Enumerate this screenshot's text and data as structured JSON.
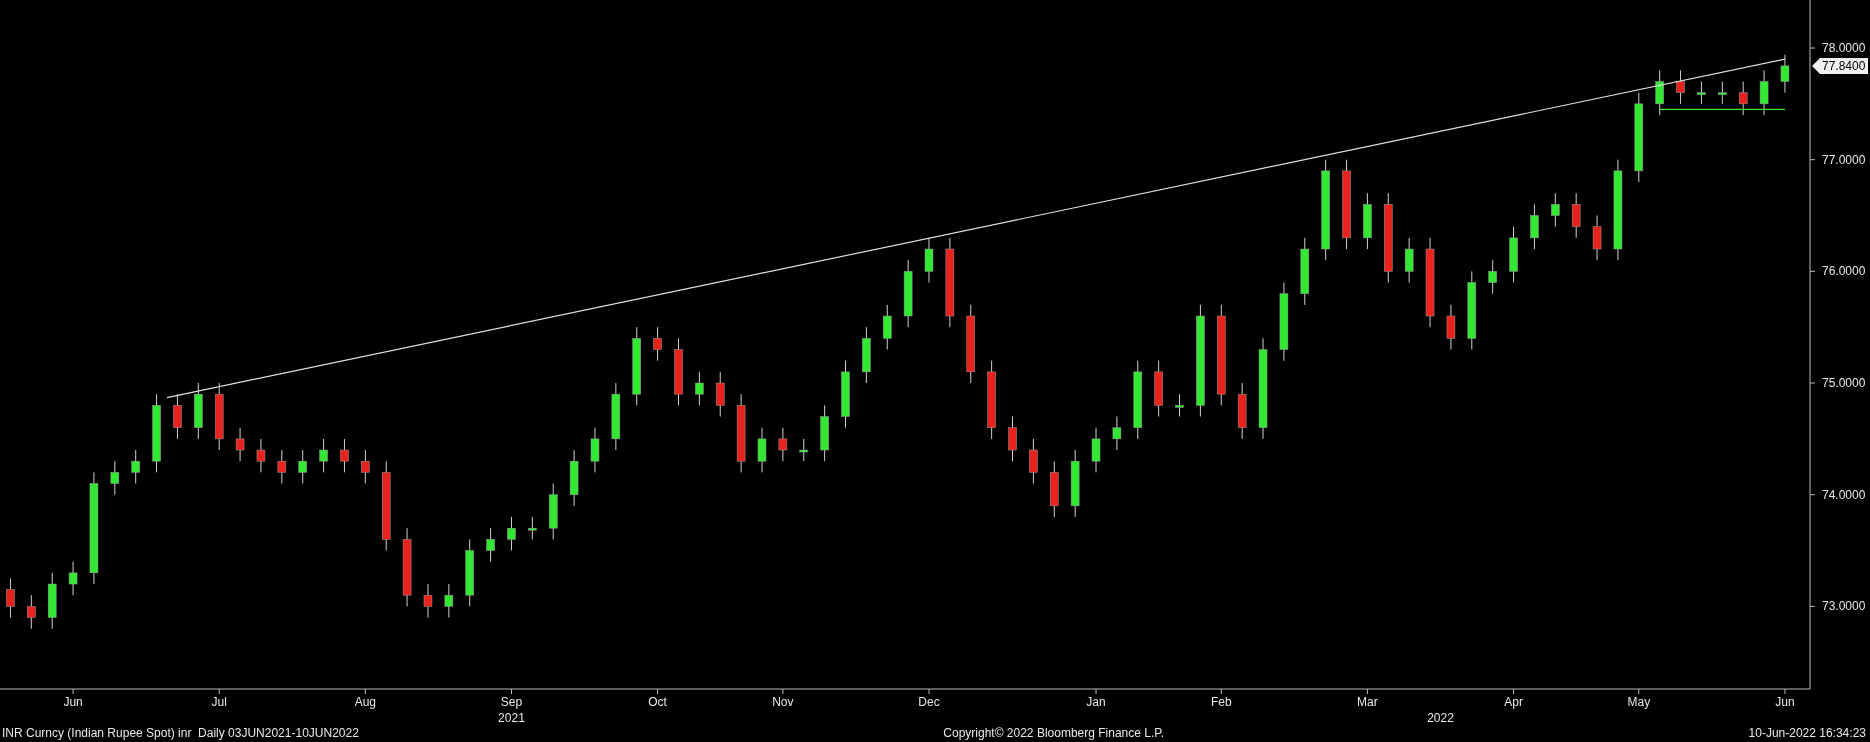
{
  "chart": {
    "chart_data": {
      "type": "candlestick",
      "ylim": [
        72.26,
        78.43
      ],
      "yticks": [
        {
          "value": 73,
          "label": "73.0000"
        },
        {
          "value": 74,
          "label": "74.0000"
        },
        {
          "value": 75,
          "label": "75.0000"
        },
        {
          "value": 76,
          "label": "76.0000"
        },
        {
          "value": 77,
          "label": "77.0000"
        },
        {
          "value": 78,
          "label": "78.0000"
        }
      ],
      "categories": [
        null,
        null,
        null,
        "Jun",
        null,
        null,
        null,
        null,
        null,
        null,
        "Jul",
        null,
        null,
        null,
        null,
        null,
        null,
        "Aug",
        null,
        null,
        null,
        null,
        null,
        null,
        "Sep",
        null,
        null,
        null,
        null,
        null,
        null,
        "Oct",
        null,
        null,
        null,
        null,
        null,
        "Nov",
        null,
        null,
        null,
        null,
        null,
        null,
        "Dec",
        null,
        null,
        null,
        null,
        null,
        null,
        null,
        "Jan",
        null,
        null,
        null,
        null,
        null,
        "Feb",
        null,
        null,
        null,
        null,
        null,
        null,
        "Mar",
        null,
        null,
        null,
        null,
        null,
        null,
        "Apr",
        null,
        null,
        null,
        null,
        null,
        "May",
        null,
        null,
        null,
        null,
        null,
        null,
        "Jun"
      ],
      "ohlc": [
        [
          73.15,
          73.25,
          72.9,
          73.0
        ],
        [
          73.0,
          73.1,
          72.8,
          72.9
        ],
        [
          72.9,
          73.3,
          72.8,
          73.2
        ],
        [
          73.2,
          73.4,
          73.1,
          73.3
        ],
        [
          73.3,
          74.2,
          73.2,
          74.1
        ],
        [
          74.1,
          74.3,
          74.0,
          74.2
        ],
        [
          74.2,
          74.4,
          74.1,
          74.3
        ],
        [
          74.3,
          74.9,
          74.2,
          74.8
        ],
        [
          74.8,
          74.9,
          74.5,
          74.6
        ],
        [
          74.6,
          75.0,
          74.5,
          74.9
        ],
        [
          74.9,
          75.0,
          74.4,
          74.5
        ],
        [
          74.5,
          74.6,
          74.3,
          74.4
        ],
        [
          74.4,
          74.5,
          74.2,
          74.3
        ],
        [
          74.3,
          74.4,
          74.1,
          74.2
        ],
        [
          74.2,
          74.4,
          74.1,
          74.3
        ],
        [
          74.3,
          74.5,
          74.2,
          74.4
        ],
        [
          74.4,
          74.5,
          74.2,
          74.3
        ],
        [
          74.3,
          74.4,
          74.1,
          74.2
        ],
        [
          74.2,
          74.3,
          73.5,
          73.6
        ],
        [
          73.6,
          73.7,
          73.0,
          73.1
        ],
        [
          73.1,
          73.2,
          72.9,
          73.0
        ],
        [
          73.0,
          73.2,
          72.9,
          73.1
        ],
        [
          73.1,
          73.6,
          73.0,
          73.5
        ],
        [
          73.5,
          73.7,
          73.4,
          73.6
        ],
        [
          73.6,
          73.8,
          73.5,
          73.7
        ],
        [
          73.7,
          73.8,
          73.6,
          73.7
        ],
        [
          73.7,
          74.1,
          73.6,
          74.0
        ],
        [
          74.0,
          74.4,
          73.9,
          74.3
        ],
        [
          74.3,
          74.6,
          74.2,
          74.5
        ],
        [
          74.5,
          75.0,
          74.4,
          74.9
        ],
        [
          74.9,
          75.5,
          74.8,
          75.4
        ],
        [
          75.4,
          75.5,
          75.2,
          75.3
        ],
        [
          75.3,
          75.4,
          74.8,
          74.9
        ],
        [
          74.9,
          75.1,
          74.8,
          75.0
        ],
        [
          75.0,
          75.1,
          74.7,
          74.8
        ],
        [
          74.8,
          74.9,
          74.2,
          74.3
        ],
        [
          74.3,
          74.6,
          74.2,
          74.5
        ],
        [
          74.5,
          74.6,
          74.3,
          74.4
        ],
        [
          74.4,
          74.5,
          74.3,
          74.4
        ],
        [
          74.4,
          74.8,
          74.3,
          74.7
        ],
        [
          74.7,
          75.2,
          74.6,
          75.1
        ],
        [
          75.1,
          75.5,
          75.0,
          75.4
        ],
        [
          75.4,
          75.7,
          75.3,
          75.6
        ],
        [
          75.6,
          76.1,
          75.5,
          76.0
        ],
        [
          76.0,
          76.3,
          75.9,
          76.2
        ],
        [
          76.2,
          76.3,
          75.5,
          75.6
        ],
        [
          75.6,
          75.7,
          75.0,
          75.1
        ],
        [
          75.1,
          75.2,
          74.5,
          74.6
        ],
        [
          74.6,
          74.7,
          74.3,
          74.4
        ],
        [
          74.4,
          74.5,
          74.1,
          74.2
        ],
        [
          74.2,
          74.3,
          73.8,
          73.9
        ],
        [
          73.9,
          74.4,
          73.8,
          74.3
        ],
        [
          74.3,
          74.6,
          74.2,
          74.5
        ],
        [
          74.5,
          74.7,
          74.4,
          74.6
        ],
        [
          74.6,
          75.2,
          74.5,
          75.1
        ],
        [
          75.1,
          75.2,
          74.7,
          74.8
        ],
        [
          74.8,
          74.9,
          74.7,
          74.8
        ],
        [
          74.8,
          75.7,
          74.7,
          75.6
        ],
        [
          75.6,
          75.7,
          74.8,
          74.9
        ],
        [
          74.9,
          75.0,
          74.5,
          74.6
        ],
        [
          74.6,
          75.4,
          74.5,
          75.3
        ],
        [
          75.3,
          75.9,
          75.2,
          75.8
        ],
        [
          75.8,
          76.3,
          75.7,
          76.2
        ],
        [
          76.2,
          77.0,
          76.1,
          76.9
        ],
        [
          76.9,
          77.0,
          76.2,
          76.3
        ],
        [
          76.3,
          76.7,
          76.2,
          76.6
        ],
        [
          76.6,
          76.7,
          75.9,
          76.0
        ],
        [
          76.0,
          76.3,
          75.9,
          76.2
        ],
        [
          76.2,
          76.3,
          75.5,
          75.6
        ],
        [
          75.6,
          75.7,
          75.3,
          75.4
        ],
        [
          75.4,
          76.0,
          75.3,
          75.9
        ],
        [
          75.9,
          76.1,
          75.8,
          76.0
        ],
        [
          76.0,
          76.4,
          75.9,
          76.3
        ],
        [
          76.3,
          76.6,
          76.2,
          76.5
        ],
        [
          76.5,
          76.7,
          76.4,
          76.6
        ],
        [
          76.6,
          76.7,
          76.3,
          76.4
        ],
        [
          76.4,
          76.5,
          76.1,
          76.2
        ],
        [
          76.2,
          77.0,
          76.1,
          76.9
        ],
        [
          76.9,
          77.6,
          76.8,
          77.5
        ],
        [
          77.5,
          77.8,
          77.4,
          77.7
        ],
        [
          77.7,
          77.8,
          77.5,
          77.6
        ],
        [
          77.6,
          77.7,
          77.5,
          77.6
        ],
        [
          77.6,
          77.7,
          77.5,
          77.6
        ],
        [
          77.6,
          77.7,
          77.4,
          77.5
        ],
        [
          77.5,
          77.8,
          77.4,
          77.7
        ],
        [
          77.7,
          77.94,
          77.6,
          77.84
        ]
      ]
    },
    "last_price": "77.8400",
    "year_labels": [
      "2021",
      "2022"
    ]
  },
  "footer": {
    "security": "INR Curncy (Indian Rupee Spot) inr  Daily 03JUN2021-10JUN2022",
    "copyright": "Copyright© 2022 Bloomberg Finance L.P.",
    "timestamp": "10-Jun-2022 16:34:23"
  }
}
